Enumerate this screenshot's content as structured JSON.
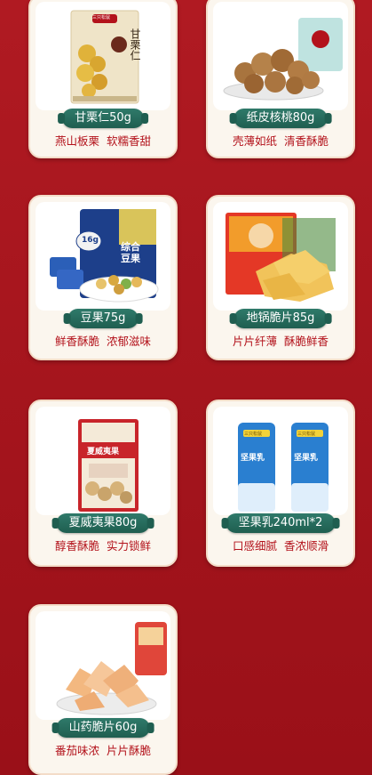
{
  "products": [
    {
      "name": "甘栗仁50g",
      "desc": "燕山板栗  软糯香甜",
      "icon": "chestnut-bag"
    },
    {
      "name": "纸皮核桃80g",
      "desc": "壳薄如纸  清香酥脆",
      "icon": "walnut-bowl"
    },
    {
      "name": "豆果75g",
      "desc": "鲜香酥脆  浓郁滋味",
      "icon": "bean-snack-bag"
    },
    {
      "name": "地锅脆片85g",
      "desc": "片片纤薄  酥脆鲜香",
      "icon": "crisp-bag"
    },
    {
      "name": "夏威夷果80g",
      "desc": "醇香酥脆  实力锁鲜",
      "icon": "macadamia-bag"
    },
    {
      "name": "坚果乳240ml*2",
      "desc": "口感细腻  香浓顺滑",
      "icon": "nut-milk-cans"
    },
    {
      "name": "山药脆片60g",
      "desc": "番茄味浓  片片酥脆",
      "icon": "yam-chips-plate"
    }
  ],
  "labels": {
    "bag1_brand": "三只松鼠",
    "bag1_title": "甘栗仁",
    "bag3_title": "综合豆果",
    "bag3_badge": "16g",
    "bag5_title": "夏威夷果",
    "can_title": "坚果乳",
    "can_brand": "三只松鼠"
  },
  "colors": {
    "accent": "#b3121b",
    "tag": "#1f5e50",
    "card": "#fbf6ee"
  }
}
